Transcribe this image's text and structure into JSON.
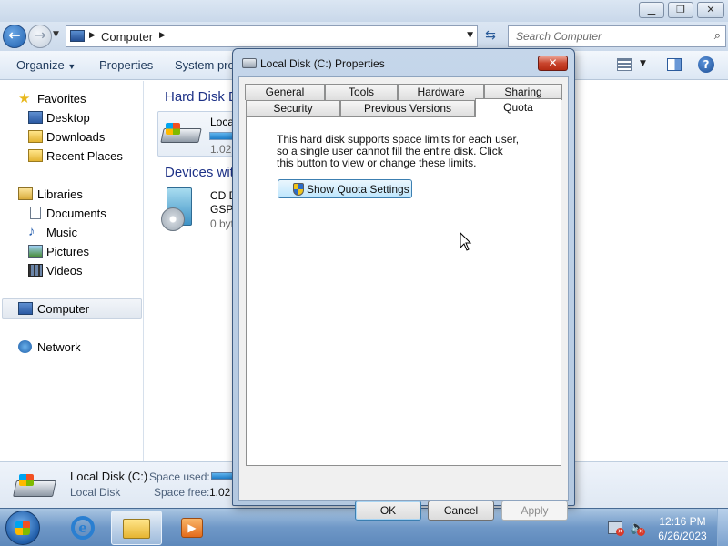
{
  "explorer": {
    "address": {
      "path": "Computer"
    },
    "search": {
      "placeholder": "Search Computer"
    },
    "toolbar": {
      "organize": "Organize",
      "properties": "Properties",
      "system_properties": "System prop"
    },
    "nav": {
      "favorites": "Favorites",
      "desktop": "Desktop",
      "downloads": "Downloads",
      "recent_places": "Recent Places",
      "libraries": "Libraries",
      "documents": "Documents",
      "music": "Music",
      "pictures": "Pictures",
      "videos": "Videos",
      "computer": "Computer",
      "network": "Network"
    },
    "content": {
      "hard_disk_header": "Hard Disk D",
      "hd_name": "Local",
      "hd_size": "1.02",
      "hd_usage_fraction": 0.95,
      "devices_header": "Devices wit",
      "cd_name": "CD D",
      "cd_label": "GSP1",
      "cd_size": "0 byt"
    },
    "details": {
      "drive_name": "Local Disk (C:)",
      "drive_type": "Local Disk",
      "space_used_label": "Space used:",
      "space_free_label": "Space free:",
      "space_free_value": "1.02"
    }
  },
  "dialog": {
    "title": "Local Disk (C:) Properties",
    "close_glyph": "✕",
    "tabs": {
      "general": "General",
      "tools": "Tools",
      "hardware": "Hardware",
      "sharing": "Sharing",
      "security": "Security",
      "previous_versions": "Previous Versions",
      "quota": "Quota"
    },
    "quota_description": "This hard disk supports space limits for each user, so a single user cannot fill the entire disk. Click this button to view or change these limits.",
    "show_quota_button": "Show Quota Settings",
    "ok": "OK",
    "cancel": "Cancel",
    "apply": "Apply"
  },
  "taskbar": {
    "time": "12:16 PM",
    "date": "6/26/2023"
  },
  "colors": {
    "accent": "#1e3287",
    "close_red": "#c9452d",
    "taskbar": "#6f98c7"
  }
}
